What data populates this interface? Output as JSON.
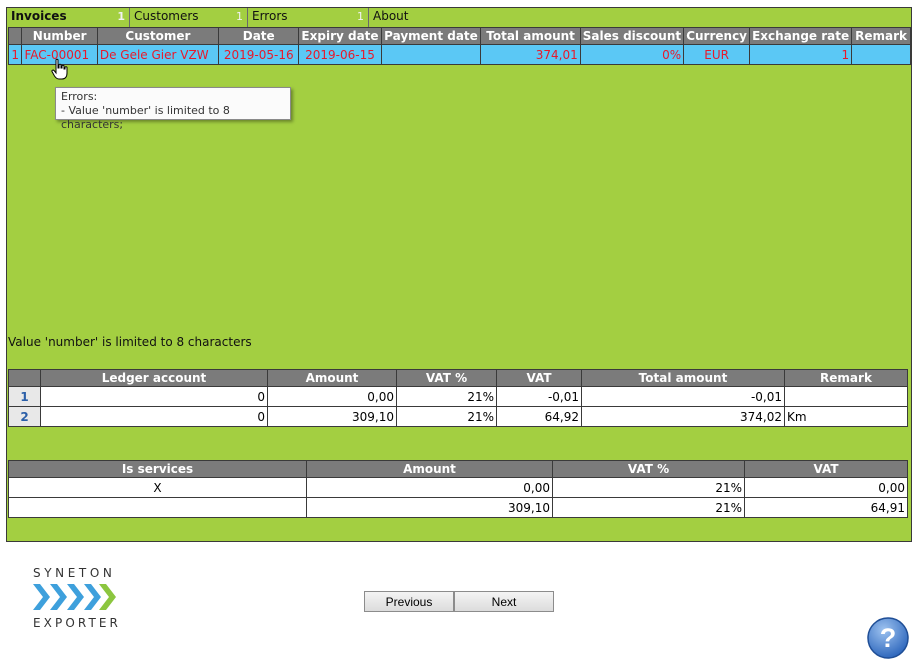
{
  "tabs": [
    {
      "label": "Invoices",
      "count": "1"
    },
    {
      "label": "Customers",
      "count": "1"
    },
    {
      "label": "Errors",
      "count": "1"
    },
    {
      "label": "About",
      "count": ""
    }
  ],
  "invoices": {
    "columns": [
      "",
      "Number",
      "Customer",
      "Date",
      "Expiry date",
      "Payment date",
      "Total amount",
      "Sales discount",
      "Currency",
      "Exchange rate",
      "Remark"
    ],
    "rows": [
      {
        "row": "1",
        "number": "FAC-00001",
        "customer": "De Gele Gier VZW",
        "date": "2019-05-16",
        "expiry": "2019-06-15",
        "payment": "",
        "total": "374,01",
        "discount": "0%",
        "currency": "EUR",
        "rate": "1",
        "remark": ""
      }
    ]
  },
  "tooltip": {
    "title": "Errors:",
    "line": "- Value 'number' is limited to 8 characters;"
  },
  "message": "Value 'number' is limited to 8 characters",
  "ledger": {
    "columns": [
      "",
      "Ledger account",
      "Amount",
      "VAT %",
      "VAT",
      "Total amount",
      "Remark"
    ],
    "rows": [
      {
        "row": "1",
        "account": "0",
        "amount": "0,00",
        "vat_pct": "21%",
        "vat": "-0,01",
        "total": "-0,01",
        "remark": ""
      },
      {
        "row": "2",
        "account": "0",
        "amount": "309,10",
        "vat_pct": "21%",
        "vat": "64,92",
        "total": "374,02",
        "remark": "Km"
      }
    ]
  },
  "services": {
    "columns": [
      "Is services",
      "Amount",
      "VAT %",
      "VAT"
    ],
    "rows": [
      {
        "is_services": "X",
        "amount": "0,00",
        "vat_pct": "21%",
        "vat": "0,00"
      },
      {
        "is_services": "",
        "amount": "309,10",
        "vat_pct": "21%",
        "vat": "64,91"
      }
    ]
  },
  "logo": {
    "top": "SYNETON",
    "bottom": "EXPORTER"
  },
  "buttons": {
    "previous": "Previous",
    "next": "Next"
  },
  "help": {
    "glyph": "?"
  },
  "colors": {
    "panel": "#a3cf41",
    "selected_row": "#5bc8f5",
    "error_text": "#e8192b",
    "header": "#7b7b7b"
  },
  "icons": [
    "hand-cursor-icon",
    "syneton-chevrons-logo",
    "help-icon"
  ]
}
